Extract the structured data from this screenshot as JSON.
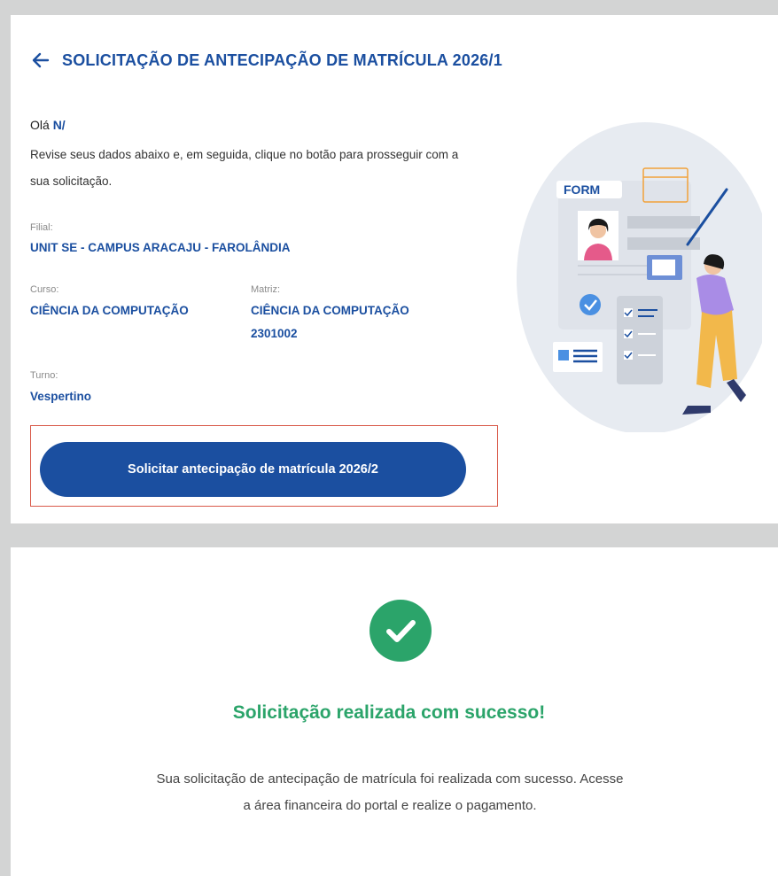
{
  "header": {
    "back_icon": "arrow-left-icon",
    "title": "SOLICITAÇÃO DE ANTECIPAÇÃO DE MATRÍCULA 2026/1"
  },
  "greeting": {
    "prefix": "Olá",
    "name": "N/"
  },
  "intro": "Revise seus dados abaixo e, em seguida, clique no botão para prosseguir com a sua solicitação.",
  "fields": {
    "filial": {
      "label": "Filial:",
      "value": "UNIT SE - CAMPUS ARACAJU - FAROLÂNDIA"
    },
    "curso": {
      "label": "Curso:",
      "value": "CIÊNCIA DA COMPUTAÇÃO"
    },
    "matriz": {
      "label": "Matriz:",
      "value": "CIÊNCIA DA COMPUTAÇÃO",
      "code": "2301002"
    },
    "turno": {
      "label": "Turno:",
      "value": "Vespertino"
    }
  },
  "cta": {
    "label": "Solicitar antecipação de matrícula 2026/2"
  },
  "illustration": {
    "form_label": "FORM"
  },
  "success": {
    "icon": "check-circle-icon",
    "title": "Solicitação realizada com sucesso!",
    "message": "Sua solicitação de antecipação de matrícula foi realizada com sucesso. Acesse a área financeira do portal e realize o pagamento."
  },
  "colors": {
    "brand_blue": "#1b4fa0",
    "success_green": "#2ba46a",
    "highlight_red": "#d95a4a",
    "page_gray": "#d3d4d4"
  }
}
